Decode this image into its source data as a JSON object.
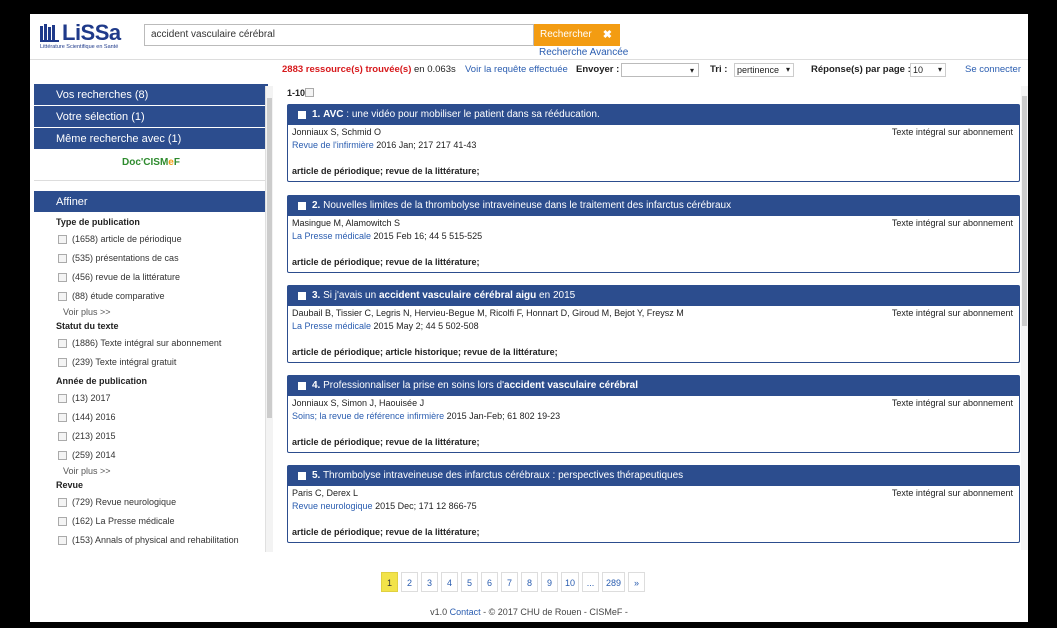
{
  "header": {
    "logo_text": "LiSSa",
    "logo_tagline": "Littérature Scientifique en Santé",
    "search_value": "accident vasculaire cérébral",
    "search_button": "Rechercher",
    "search_clear": "✖",
    "advanced_search": "Recherche Avancée"
  },
  "results_bar": {
    "found_count": "2883 ressource(s) trouvée(s)",
    "found_time": " en 0.063s",
    "query_link": "Voir la requête effectuée",
    "send_label": "Envoyer :",
    "sort_label": "Tri :",
    "sort_value": "pertinence",
    "per_page_label": "Réponse(s) par page :",
    "per_page_value": "10",
    "login_link": "Se connecter"
  },
  "sidebar": {
    "my_searches": "Vos recherches (8)",
    "my_selection": "Votre sélection (1)",
    "same_search": "Même recherche avec (1)",
    "doc_cismef": {
      "a": "Doc'CISM",
      "b": "e",
      "c": "F"
    },
    "refine": "Affiner",
    "see_more": "Voir plus >>",
    "facets": [
      {
        "title": "Type de publication",
        "items": [
          "(1658) article de périodique",
          "(535) présentations de cas",
          "(456) revue de la littérature",
          "(88) étude comparative"
        ],
        "more": true
      },
      {
        "title": "Statut du texte",
        "items": [
          "(1886) Texte intégral sur abonnement",
          "(239) Texte intégral gratuit"
        ],
        "more": false
      },
      {
        "title": "Année de publication",
        "items": [
          "(13) 2017",
          "(144) 2016",
          "(213) 2015",
          "(259) 2014"
        ],
        "more": true
      },
      {
        "title": "Revue",
        "items": [
          "(729) Revue neurologique",
          "(162) La Presse médicale",
          "(153) Annals of physical and rehabilitation"
        ],
        "more": false
      }
    ]
  },
  "results": {
    "range": "1-10",
    "items": [
      {
        "num": "1.",
        "title_parts": [
          {
            "t": "AVC",
            "b": true
          },
          {
            "t": " : une vidéo pour mobiliser le patient dans sa rééducation.",
            "b": false
          }
        ],
        "authors": "Jonniaux S, Schmid O",
        "journal": "Revue de l'infirmière",
        "details": "  2016   Jan; 217 217 41-43",
        "access": "Texte intégral sur abonnement",
        "types": "article de périodique;   revue de la littérature;"
      },
      {
        "num": "2.",
        "title_parts": [
          {
            "t": "Nouvelles limites de la thrombolyse intraveineuse dans le traitement des infarctus cérébraux",
            "b": false
          }
        ],
        "authors": "Masingue M, Alamowitch S",
        "journal": "La Presse médicale",
        "details": "  2015   Feb 16; 44 5 515-525",
        "access": "Texte intégral sur abonnement",
        "types": "article de périodique;   revue de la littérature;"
      },
      {
        "num": "3.",
        "title_parts": [
          {
            "t": "Si j'avais un ",
            "b": false
          },
          {
            "t": "accident vasculaire cérébral aigu",
            "b": true
          },
          {
            "t": " en 2015",
            "b": false
          }
        ],
        "authors": "Daubail B, Tissier C, Legris N, Hervieu-Begue M, Ricolfi F, Honnart D, Giroud M, Bejot Y, Freysz M",
        "journal": "La Presse médicale",
        "details": "  2015   May 2; 44 5 502-508",
        "access": "Texte intégral sur abonnement",
        "types": "article de périodique;   article historique;   revue de la littérature;"
      },
      {
        "num": "4.",
        "title_parts": [
          {
            "t": "Professionnaliser la prise en soins lors d'",
            "b": false
          },
          {
            "t": "accident vasculaire cérébral",
            "b": true
          }
        ],
        "authors": "Jonniaux S, Simon J, Haouisée J",
        "journal": "Soins; la revue de référence infirmière",
        "details": "  2015   Jan-Feb; 61 802 19-23",
        "access": "Texte intégral sur abonnement",
        "types": "article de périodique;   revue de la littérature;"
      },
      {
        "num": "5.",
        "title_parts": [
          {
            "t": "Thrombolyse intraveineuse des infarctus cérébraux : perspectives thérapeutiques",
            "b": false
          }
        ],
        "authors": "Paris C, Derex L",
        "journal": "Revue neurologique",
        "details": "  2015   Dec; 171 12 866-75",
        "access": "Texte intégral sur abonnement",
        "types": "article de périodique;   revue de la littérature;"
      }
    ]
  },
  "pagination": {
    "pages": [
      "1",
      "2",
      "3",
      "4",
      "5",
      "6",
      "7",
      "8",
      "9",
      "10",
      "...",
      "289",
      "»"
    ],
    "active": "1"
  },
  "footer": {
    "version": "v1.0 ",
    "contact": "Contact",
    "rest": " - © 2017 CHU de Rouen - CISMeF -"
  },
  "colors": {
    "navy": "#2c4d8e",
    "orange": "#f39c12",
    "link": "#2a5db0",
    "red": "#d7191c"
  }
}
